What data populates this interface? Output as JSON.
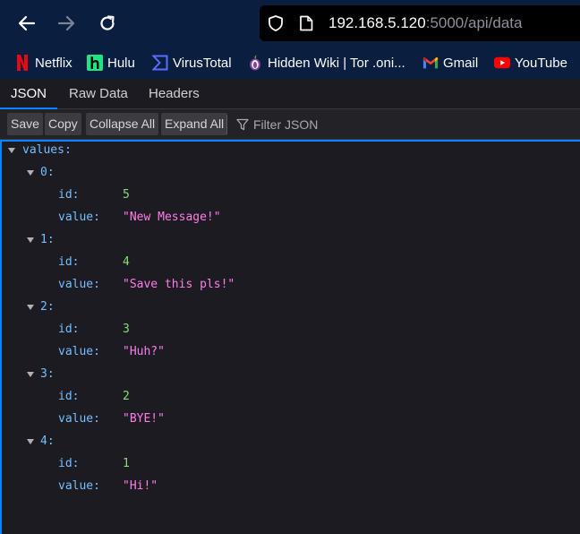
{
  "browser": {
    "url_host": "192.168.5.120",
    "url_rest": ":5000/api/data",
    "bookmarks": [
      {
        "label": "Netflix",
        "icon": "netflix-icon",
        "color": "#e50914"
      },
      {
        "label": "Hulu",
        "icon": "hulu-icon",
        "color": "#1ce783"
      },
      {
        "label": "VirusTotal",
        "icon": "virustotal-icon",
        "color": "#394eff"
      },
      {
        "label": "Hidden Wiki | Tor .oni...",
        "icon": "tor-onion-icon",
        "color": "#7d4698"
      },
      {
        "label": "Gmail",
        "icon": "gmail-icon",
        "color": "#ea4335"
      },
      {
        "label": "YouTube",
        "icon": "youtube-icon",
        "color": "#ff0000"
      }
    ]
  },
  "viewer": {
    "tabs": [
      "JSON",
      "Raw Data",
      "Headers"
    ],
    "selected_tab": "JSON",
    "toolbar": {
      "save": "Save",
      "copy": "Copy",
      "collapse_all": "Collapse All",
      "expand_all": "Expand All"
    },
    "filter_placeholder": "Filter JSON"
  },
  "json": {
    "root_key": "values:",
    "id_key": "id:",
    "value_key": "value:",
    "items": [
      {
        "index": "0:",
        "id": "5",
        "value": "\"New Message!\""
      },
      {
        "index": "1:",
        "id": "4",
        "value": "\"Save this pls!\""
      },
      {
        "index": "2:",
        "id": "3",
        "value": "\"Huh?\""
      },
      {
        "index": "3:",
        "id": "2",
        "value": "\"BYE!\""
      },
      {
        "index": "4:",
        "id": "1",
        "value": "\"Hi!\""
      }
    ]
  }
}
